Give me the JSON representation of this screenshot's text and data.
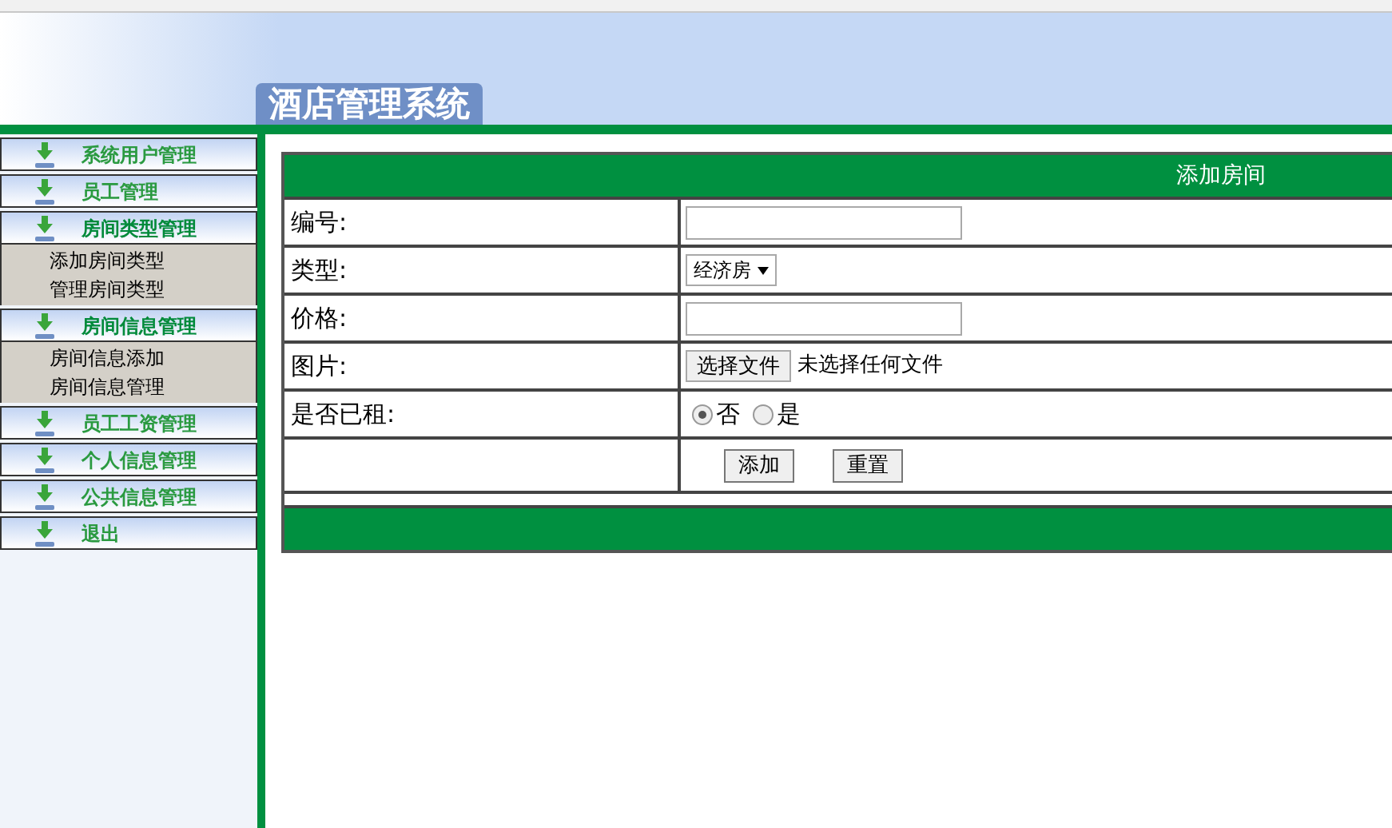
{
  "header": {
    "title": "酒店管理系统"
  },
  "sidebar": {
    "groups": [
      {
        "label": "系统用户管理",
        "expanded": false
      },
      {
        "label": "员工管理",
        "expanded": false
      },
      {
        "label": "房间类型管理",
        "expanded": true,
        "children": [
          "添加房间类型",
          "管理房间类型"
        ]
      },
      {
        "label": "房间信息管理",
        "expanded": true,
        "children": [
          "房间信息添加",
          "房间信息管理"
        ]
      },
      {
        "label": "员工工资管理",
        "expanded": false
      },
      {
        "label": "个人信息管理",
        "expanded": false
      },
      {
        "label": "公共信息管理",
        "expanded": false
      },
      {
        "label": "退出",
        "expanded": false
      }
    ]
  },
  "form": {
    "title": "添加房间",
    "rows": [
      {
        "label": "编号:",
        "kind": "text"
      },
      {
        "label": "类型:",
        "kind": "select",
        "value": "经济房"
      },
      {
        "label": "价格:",
        "kind": "text"
      },
      {
        "label": "图片:",
        "kind": "file",
        "button": "选择文件",
        "status": "未选择任何文件"
      },
      {
        "label": "是否已租:",
        "kind": "radio",
        "options": [
          {
            "label": "否",
            "selected": true
          },
          {
            "label": "是",
            "selected": false
          }
        ]
      }
    ],
    "buttons": [
      "添加",
      "重置"
    ]
  }
}
